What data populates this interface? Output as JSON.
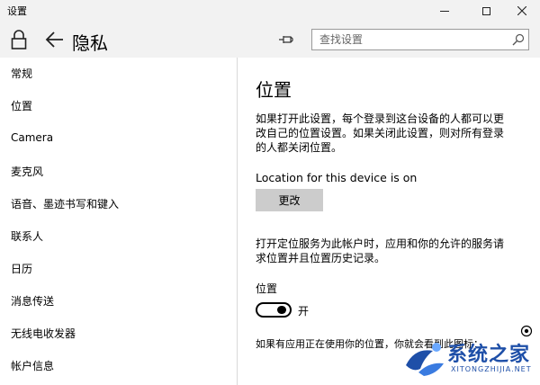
{
  "window": {
    "title": "设置"
  },
  "header": {
    "page_title": "隐私",
    "search_placeholder": "查找设置"
  },
  "sidebar": {
    "items": [
      {
        "label": "常规"
      },
      {
        "label": "位置"
      },
      {
        "label": "Camera"
      },
      {
        "label": "麦克风"
      },
      {
        "label": "语音、墨迹书写和键入"
      },
      {
        "label": "联系人"
      },
      {
        "label": "日历"
      },
      {
        "label": "消息传送"
      },
      {
        "label": "无线电收发器"
      },
      {
        "label": "帐户信息"
      }
    ]
  },
  "main": {
    "title": "位置",
    "desc1_line1": "如果打开此设置，每个登录到这台设备的人都可以更",
    "desc1_line2": "改自己的位置设置。如果关闭此设置，则对所有登录",
    "desc1_line3": "的人都关闭位置。",
    "status": "Location for this device is on",
    "change_button": "更改",
    "desc2_line1": "打开定位服务为此帐户时，应用和你的允许的服务请",
    "desc2_line2": "求位置并且位置历史记录。",
    "toggle_label": "位置",
    "toggle_state": "开",
    "toggle_on": true,
    "footnote": "如果有应用正在使用你的位置，你就会看到此图标："
  },
  "watermark": {
    "text": "系统之家",
    "sub": "XITONGZHIJIA.NET"
  },
  "colors": {
    "chrome": "#f2f2f2",
    "button": "#cccccc",
    "watermark": "#1e4fa8"
  }
}
